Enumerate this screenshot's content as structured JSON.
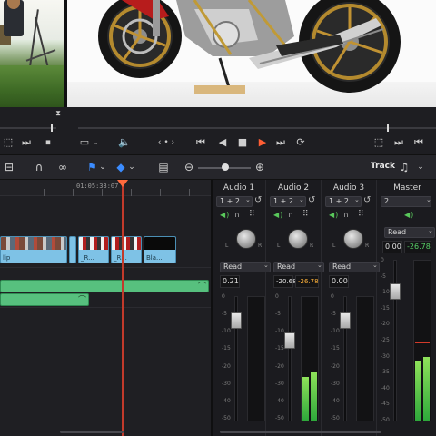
{
  "viewer": {
    "left_source": "clip preview",
    "right_source": "motorcycle preview"
  },
  "timeline": {
    "timecode": "01:05:33:07",
    "video_clips": [
      {
        "label": "lip"
      },
      {
        "label": "_R..."
      },
      {
        "label": "_R..."
      },
      {
        "label": "Bla..."
      }
    ]
  },
  "toolbar": {
    "track_label": "Track"
  },
  "mixer": {
    "channels": [
      {
        "name": "Audio 1",
        "routing": "1 + 2",
        "automation": "Read",
        "value": "0.21",
        "level": "",
        "pan_l": "L",
        "pan_r": "R"
      },
      {
        "name": "Audio 2",
        "routing": "1 + 2",
        "automation": "Read",
        "value": "-20.68",
        "level": "-26.78",
        "pan_l": "L",
        "pan_r": "R"
      },
      {
        "name": "Audio 3",
        "routing": "1 + 2",
        "automation": "Read",
        "value": "0.00",
        "level": "",
        "pan_l": "L",
        "pan_r": "R"
      },
      {
        "name": "Master",
        "routing": "2",
        "automation": "Read",
        "value": "0.00",
        "level": "-26.78"
      }
    ],
    "scale": [
      "0",
      "-5",
      "-10",
      "-15",
      "-20",
      "-30",
      "-40",
      "-50"
    ],
    "meter_scale": [
      "0",
      "-5",
      "-10",
      "-15",
      "-20",
      "-25",
      "-30",
      "-35",
      "-40",
      "-45",
      "-50"
    ]
  },
  "colors": {
    "accent_red": "#ff5e34",
    "clip_blue": "#7ec2e6",
    "clip_green": "#57c07e",
    "meter_green": "#2ea83b",
    "value_orange": "#ffb23a"
  }
}
